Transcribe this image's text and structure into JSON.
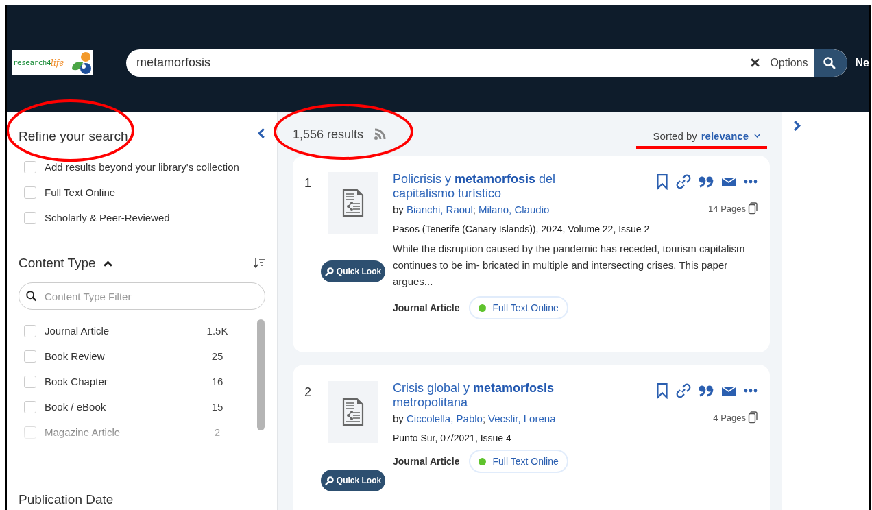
{
  "header": {
    "logo": {
      "text": "research4",
      "accent": "life"
    },
    "search": {
      "value": "metamorfosis",
      "options_label": "Options"
    },
    "nav_cut": "Ne"
  },
  "sidebar": {
    "title": "Refine your search",
    "title_circled": true,
    "filters": [
      {
        "label": "Add results beyond your library's collection",
        "checked": false
      },
      {
        "label": "Full Text Online",
        "checked": false
      },
      {
        "label": "Scholarly & Peer-Reviewed",
        "checked": false
      }
    ],
    "content_type": {
      "title": "Content Type",
      "expanded": true,
      "filter_placeholder": "Content Type Filter",
      "items": [
        {
          "label": "Journal Article",
          "count": "1.5K",
          "checked": false
        },
        {
          "label": "Book Review",
          "count": "25",
          "checked": false
        },
        {
          "label": "Book Chapter",
          "count": "16",
          "checked": false
        },
        {
          "label": "Book / eBook",
          "count": "15",
          "checked": false
        },
        {
          "label": "Magazine Article",
          "count": "2",
          "checked": false
        }
      ]
    },
    "publication_date_title": "Publication Date"
  },
  "results": {
    "count": "1,556 results",
    "count_circled": true,
    "sort_prefix": "Sorted by",
    "sort_value": "relevance",
    "sort_underlined": true,
    "items": [
      {
        "number": "1",
        "title": "Policrisis y **metamorfosis** del capitalismo turístico",
        "by": "by",
        "authors": [
          "Bianchi, Raoul",
          "Milano, Claudio"
        ],
        "author_separator": ";",
        "pages": "14 Pages",
        "source": "Pasos (Tenerife (Canary Islands)), 2024, Volume 22, Issue 2",
        "abstract": "While the disruption caused by the pandemic has receded, tourism capitalism continues to be im- bricated in multiple and intersecting crises. This paper argues...",
        "type": "Journal Article",
        "availability": "Full Text Online",
        "quick_look": "Quick Look"
      },
      {
        "number": "2",
        "title": "Crisis global y **metamorfosis** metropolitana",
        "by": "by",
        "authors": [
          "Ciccolella, Pablo",
          "Vecslir, Lorena"
        ],
        "author_separator": ";",
        "pages": "4 Pages",
        "source": "Punto Sur, 07/2021, Issue 4",
        "type": "Journal Article",
        "availability": "Full Text Online",
        "quick_look": "Quick Look"
      }
    ]
  }
}
